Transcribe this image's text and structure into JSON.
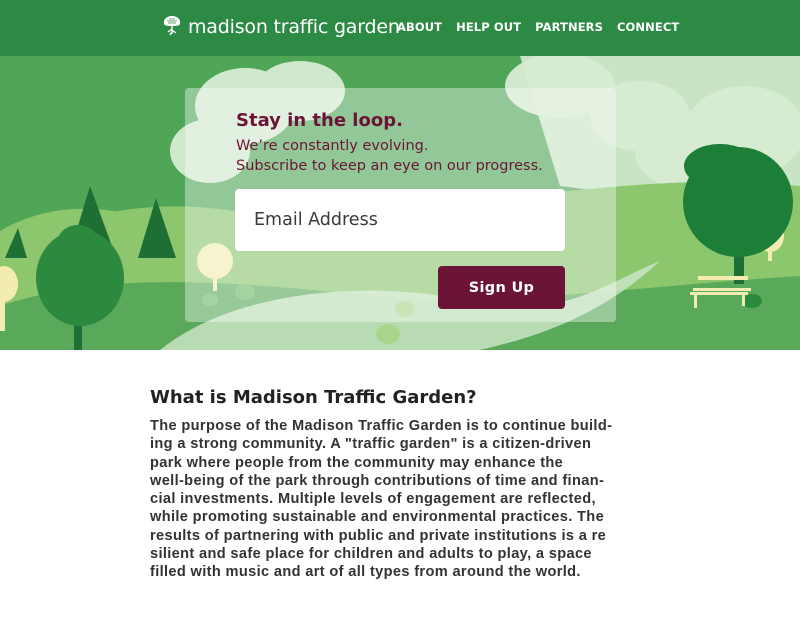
{
  "brand": {
    "name": "madison traffic garden",
    "logo_icon": "tree-logo-icon"
  },
  "nav": {
    "items": [
      "ABOUT",
      "HELP OUT",
      "PARTNERS",
      "CONNECT"
    ]
  },
  "signup": {
    "title": "Stay in the loop.",
    "subtitle_lines": [
      "We’re constantly evolving.",
      "Subscribe to keep an eye on our progress."
    ],
    "email_placeholder": "Email Address",
    "button_label": "Sign Up"
  },
  "about": {
    "heading": "What is Madison Traffic Garden?",
    "body_lines": [
      "The purpose of the Madison Traffic Garden is to continue build-",
      "ing a strong community. A \"traffic garden\" is a citizen-driven",
      "park where people from the community may enhance the",
      "well-being of the park through contributions of time and finan-",
      "cial investments. Multiple levels of engagement are reflected,",
      "while promoting sustainable and environmental practices. The",
      "results of partnering with public and private institutions is a re",
      "silient and safe place for children and adults to play, a space",
      "filled with music and art of all types from around the world."
    ]
  },
  "colors": {
    "nav_green": "#2d8a45",
    "brand_maroon": "#6b1437",
    "hill_light": "#8cc66d",
    "hill_mid": "#5aa95a",
    "tree_dark": "#1d6f33"
  }
}
